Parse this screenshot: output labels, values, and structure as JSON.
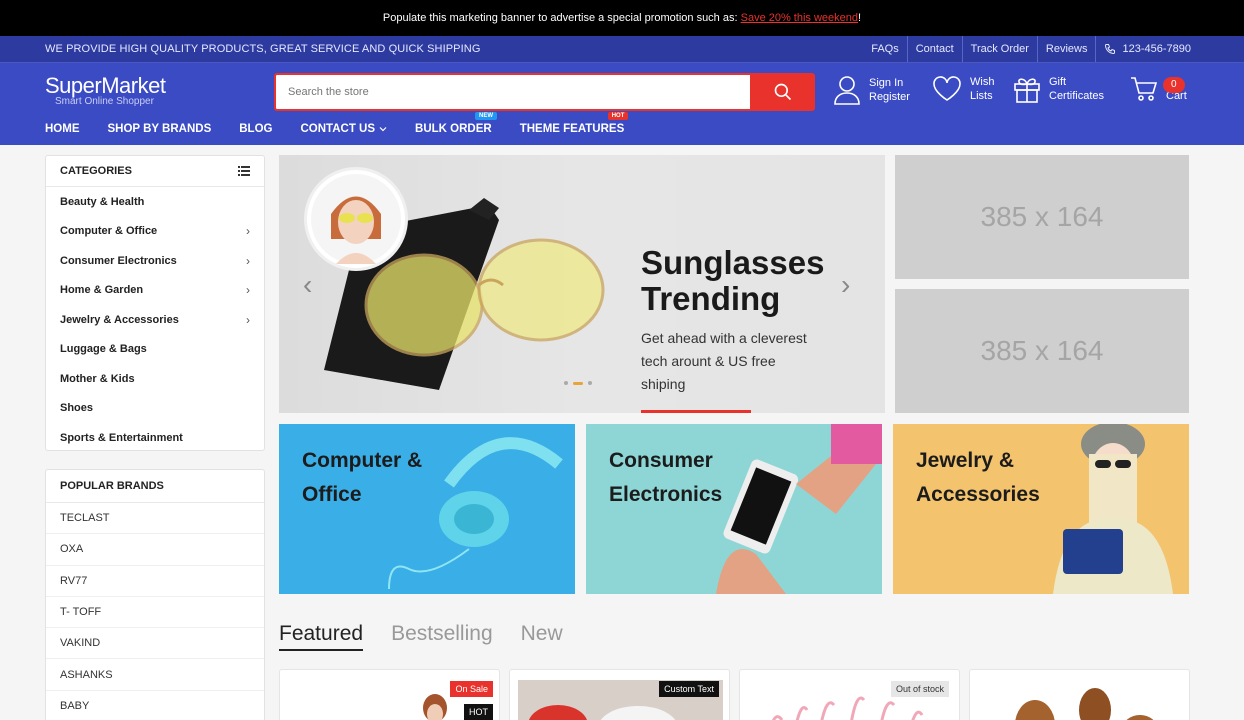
{
  "promo": {
    "text": "Populate this marketing banner to advertise a special promotion such as: ",
    "link": "Save 20% this weekend",
    "suffix": "!"
  },
  "topbar": {
    "tagline": "WE PROVIDE HIGH QUALITY PRODUCTS, GREAT SERVICE AND QUICK SHIPPING",
    "links": [
      "FAQs",
      "Contact",
      "Track Order",
      "Reviews"
    ],
    "phone": "123-456-7890"
  },
  "header": {
    "logo": {
      "name_bold": "Super",
      "name_rest": "Market",
      "sub": "Smart Online Shopper"
    },
    "search": {
      "placeholder": "Search the store"
    },
    "account": {
      "line1": "Sign In",
      "line2": "Register"
    },
    "wishlist": {
      "line1": "Wish",
      "line2": "Lists"
    },
    "gift": {
      "line1": "Gift",
      "line2": "Certificates"
    },
    "cart": {
      "label": "Cart",
      "count": "0"
    }
  },
  "nav": {
    "items": [
      "HOME",
      "SHOP BY BRANDS",
      "BLOG",
      "CONTACT US",
      "BULK ORDER",
      "THEME FEATURES"
    ],
    "tag_new": "NEW",
    "tag_hot": "HOT"
  },
  "sidebar": {
    "categories_title": "CATEGORIES",
    "categories": [
      {
        "label": "Beauty & Health",
        "chevron": ""
      },
      {
        "label": "Computer & Office",
        "chevron": "›"
      },
      {
        "label": "Consumer Electronics",
        "chevron": "›"
      },
      {
        "label": "Home & Garden",
        "chevron": "›"
      },
      {
        "label": "Jewelry & Accessories",
        "chevron": "›"
      },
      {
        "label": "Luggage & Bags",
        "chevron": ""
      },
      {
        "label": "Mother & Kids",
        "chevron": ""
      },
      {
        "label": "Shoes",
        "chevron": ""
      },
      {
        "label": "Sports & Entertainment",
        "chevron": ""
      }
    ],
    "brands_title": "POPULAR BRANDS",
    "brands": [
      "TECLAST",
      "OXA",
      "RV77",
      "T- TOFF",
      "VAKIND",
      "ASHANKS",
      "BABY"
    ]
  },
  "hero": {
    "title_line1": "Sunglasses",
    "title_line2": "Trending",
    "desc": "Get ahead with a cleverest tech arount & US free shiping",
    "prev": "‹",
    "next": "›"
  },
  "placeholders": [
    "385 x 164",
    "385 x 164"
  ],
  "tiles": [
    {
      "line1": "Computer &",
      "line2": "Office",
      "color": "#3aaee6"
    },
    {
      "line1": "Consumer",
      "line2": "Electronics",
      "color": "#8ed6d6"
    },
    {
      "line1": "Jewelry &",
      "line2": "Accessories",
      "color": "#f4c36e"
    }
  ],
  "tabs": [
    "Featured",
    "Bestselling",
    "New"
  ],
  "cards": {
    "badge_sale": "On Sale",
    "badge_hot": "HOT",
    "badge_custom": "Custom Text",
    "badge_out": "Out of stock"
  },
  "colors": {
    "primary": "#3b4bc4",
    "topbar": "#2d3aa0",
    "accent": "#e8322b"
  }
}
